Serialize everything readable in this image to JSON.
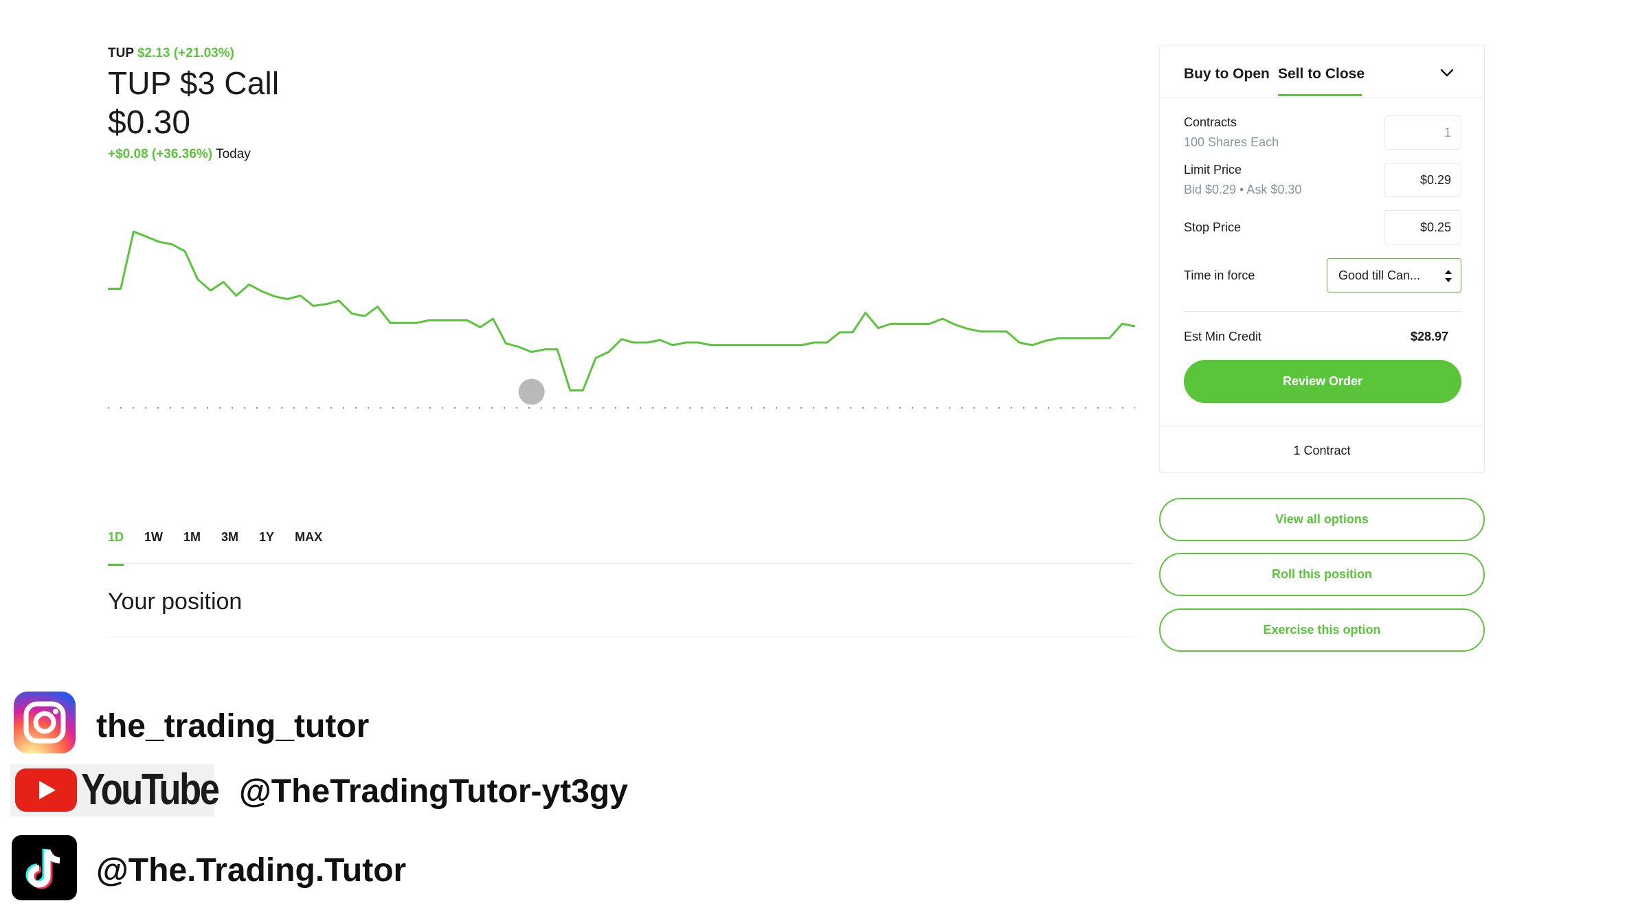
{
  "header": {
    "ticker": "TUP",
    "underlying_price": "$2.13",
    "underlying_change": "(+21.03%)",
    "contract_title": "TUP $3 Call",
    "price": "$0.30",
    "change": "+$0.08 (+36.36%)",
    "change_period": "Today"
  },
  "colors": {
    "accent_green": "#5ac53b",
    "text": "#1b1b1b",
    "muted": "#8b959b",
    "border": "#e3e9ed",
    "cursor_dot": "#b9b9b9"
  },
  "chart_data": {
    "type": "line",
    "title": "",
    "xlabel": "",
    "ylabel": "",
    "baseline": "dotted previous-close line",
    "ylim": [
      0.1,
      0.47
    ],
    "series": [
      {
        "values": [
          0.365,
          0.365,
          0.432,
          0.426,
          0.42,
          0.417,
          0.409,
          0.376,
          0.363,
          0.373,
          0.357,
          0.37,
          0.362,
          0.356,
          0.353,
          0.357,
          0.345,
          0.347,
          0.351,
          0.336,
          0.333,
          0.344,
          0.325,
          0.325,
          0.325,
          0.328,
          0.328,
          0.328,
          0.328,
          0.32,
          0.33,
          0.301,
          0.297,
          0.291,
          0.294,
          0.294,
          0.246,
          0.246,
          0.284,
          0.291,
          0.306,
          0.302,
          0.302,
          0.305,
          0.299,
          0.302,
          0.302,
          0.299,
          0.299,
          0.299,
          0.299,
          0.299,
          0.299,
          0.299,
          0.299,
          0.302,
          0.302,
          0.314,
          0.314,
          0.337,
          0.319,
          0.324,
          0.324,
          0.324,
          0.324,
          0.33,
          0.323,
          0.318,
          0.315,
          0.315,
          0.315,
          0.302,
          0.299,
          0.304,
          0.307,
          0.307,
          0.307,
          0.307,
          0.307,
          0.324,
          0.321
        ],
        "cursor_index": 33
      }
    ],
    "ranges": [
      "1D",
      "1W",
      "1M",
      "3M",
      "1Y",
      "MAX"
    ],
    "active_range": "1D"
  },
  "position": {
    "title": "Your position"
  },
  "order": {
    "tabs": [
      "Buy to Open",
      "Sell to Close"
    ],
    "active_tab": "Sell to Close",
    "contracts_label": "Contracts",
    "contracts_sub": "100 Shares Each",
    "contracts_value": "1",
    "limit_label": "Limit Price",
    "limit_sub": "Bid $0.29 • Ask $0.30",
    "limit_value": "$0.29",
    "stop_label": "Stop Price",
    "stop_value": "$0.25",
    "tif_label": "Time in force",
    "tif_value": "Good till Can...",
    "est_label": "Est Min Credit",
    "est_value": "$28.97",
    "review_label": "Review Order",
    "footer": "1 Contract"
  },
  "actions": {
    "view_all": "View all options",
    "roll": "Roll this position",
    "exercise": "Exercise this option"
  },
  "social": {
    "instagram": "the_trading_tutor",
    "youtube_logo": "YouTube",
    "youtube": "@TheTradingTutor-yt3gy",
    "tiktok": "@The.Trading.Tutor"
  }
}
